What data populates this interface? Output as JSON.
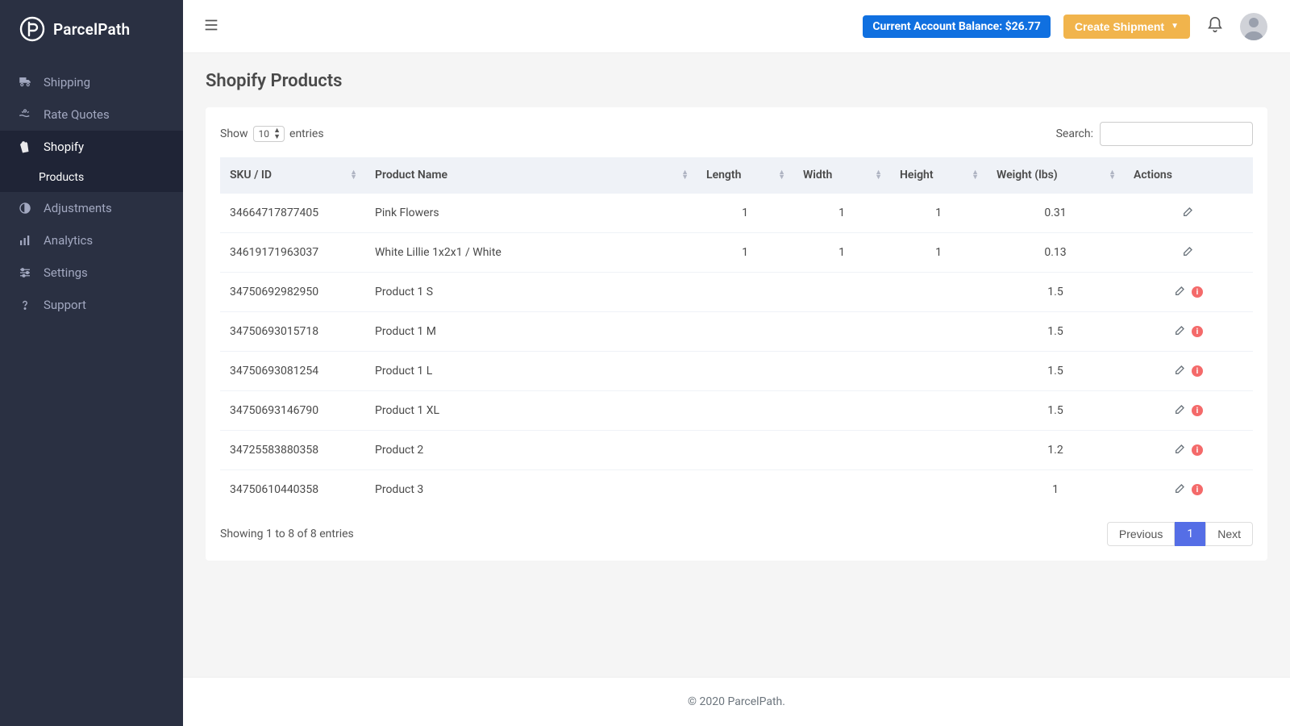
{
  "brand": {
    "name": "ParcelPath"
  },
  "sidebar": {
    "items": [
      {
        "label": "Shipping",
        "icon": "truck"
      },
      {
        "label": "Rate Quotes",
        "icon": "hand-coins"
      },
      {
        "label": "Shopify",
        "icon": "shopify",
        "active": true,
        "sub": [
          {
            "label": "Products"
          }
        ]
      },
      {
        "label": "Adjustments",
        "icon": "contrast"
      },
      {
        "label": "Analytics",
        "icon": "bar-chart"
      },
      {
        "label": "Settings",
        "icon": "sliders"
      },
      {
        "label": "Support",
        "icon": "question"
      }
    ]
  },
  "topbar": {
    "balance_label": "Current Account Balance: $26.77",
    "create_label": "Create Shipment"
  },
  "page": {
    "title": "Shopify Products"
  },
  "table": {
    "show_label_pre": "Show",
    "show_value": "10",
    "show_label_post": "entries",
    "search_label": "Search:",
    "search_value": "",
    "columns": [
      {
        "label": "SKU / ID"
      },
      {
        "label": "Product Name"
      },
      {
        "label": "Length"
      },
      {
        "label": "Width"
      },
      {
        "label": "Height"
      },
      {
        "label": "Weight (lbs)"
      },
      {
        "label": "Actions"
      }
    ],
    "rows": [
      {
        "sku": "34664717877405",
        "name": "Pink Flowers",
        "length": "1",
        "width": "1",
        "height": "1",
        "weight": "0.31",
        "warn": false
      },
      {
        "sku": "34619171963037",
        "name": "White Lillie 1x2x1 / White",
        "length": "1",
        "width": "1",
        "height": "1",
        "weight": "0.13",
        "warn": false
      },
      {
        "sku": "34750692982950",
        "name": "Product 1 S",
        "length": "",
        "width": "",
        "height": "",
        "weight": "1.5",
        "warn": true
      },
      {
        "sku": "34750693015718",
        "name": "Product 1 M",
        "length": "",
        "width": "",
        "height": "",
        "weight": "1.5",
        "warn": true
      },
      {
        "sku": "34750693081254",
        "name": "Product 1 L",
        "length": "",
        "width": "",
        "height": "",
        "weight": "1.5",
        "warn": true
      },
      {
        "sku": "34750693146790",
        "name": "Product 1 XL",
        "length": "",
        "width": "",
        "height": "",
        "weight": "1.5",
        "warn": true
      },
      {
        "sku": "34725583880358",
        "name": "Product 2",
        "length": "",
        "width": "",
        "height": "",
        "weight": "1.2",
        "warn": true
      },
      {
        "sku": "34750610440358",
        "name": "Product 3",
        "length": "",
        "width": "",
        "height": "",
        "weight": "1",
        "warn": true
      }
    ],
    "info": "Showing 1 to 8 of 8 entries",
    "prev_label": "Previous",
    "page_number": "1",
    "next_label": "Next"
  },
  "footer": {
    "text": "© 2020 ParcelPath."
  }
}
